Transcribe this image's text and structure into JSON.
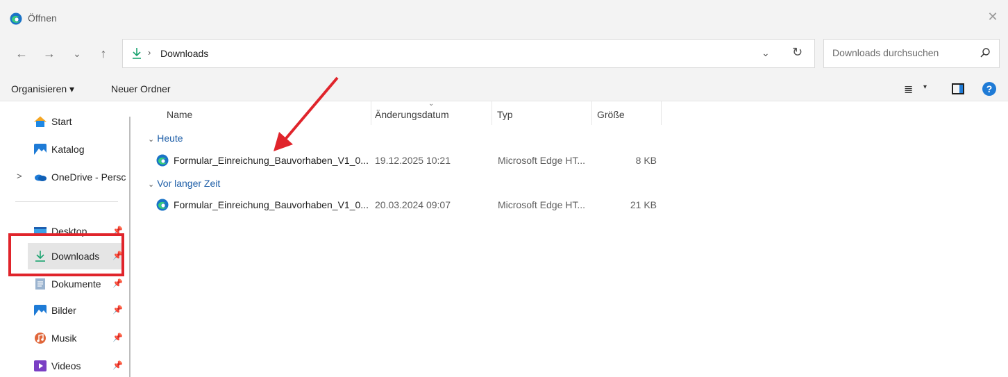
{
  "window": {
    "title": "Öffnen",
    "close_glyph": "✕"
  },
  "nav": {
    "back": "←",
    "forward": "→",
    "recent": "⌄",
    "up": "↑",
    "breadcrumb_separator": "›",
    "breadcrumb": "Downloads",
    "address_dropdown": "⌄",
    "refresh": "↻"
  },
  "search": {
    "placeholder": "Downloads durchsuchen"
  },
  "commands": {
    "organize": "Organisieren ▾",
    "new_folder": "Neuer Ordner",
    "view_glyph": "≣",
    "view_caret": "▾",
    "help": "?"
  },
  "sidebar": {
    "expander_glyph": ">",
    "pin_glyph": "📌",
    "items": [
      {
        "label": "Start",
        "icon": "home-icon"
      },
      {
        "label": "Katalog",
        "icon": "gallery-icon"
      },
      {
        "label": "OneDrive - Persc",
        "icon": "onedrive-icon"
      },
      {
        "label": "Desktop",
        "icon": "desktop-icon",
        "pinned": true
      },
      {
        "label": "Downloads",
        "icon": "download-icon",
        "pinned": true,
        "selected": true
      },
      {
        "label": "Dokumente",
        "icon": "documents-icon",
        "pinned": true
      },
      {
        "label": "Bilder",
        "icon": "pictures-icon",
        "pinned": true
      },
      {
        "label": "Musik",
        "icon": "music-icon",
        "pinned": true
      },
      {
        "label": "Videos",
        "icon": "videos-icon",
        "pinned": true
      }
    ]
  },
  "columns": {
    "name": "Name",
    "date": "Änderungsdatum",
    "type": "Typ",
    "size": "Größe"
  },
  "groups": [
    {
      "label": "Heute",
      "files": [
        {
          "name": "Formular_Einreichung_Bauvorhaben_V1_0...",
          "date": "19.12.2025 10:21",
          "type": "Microsoft Edge HT...",
          "size": "8 KB"
        }
      ]
    },
    {
      "label": "Vor langer Zeit",
      "files": [
        {
          "name": "Formular_Einreichung_Bauvorhaben_V1_0...",
          "date": "20.03.2024 09:07",
          "type": "Microsoft Edge HT...",
          "size": "21 KB"
        }
      ]
    }
  ],
  "colors": {
    "accent": "#1f7bd6",
    "annotation": "#e0242b",
    "download_green": "#1aa36f"
  }
}
